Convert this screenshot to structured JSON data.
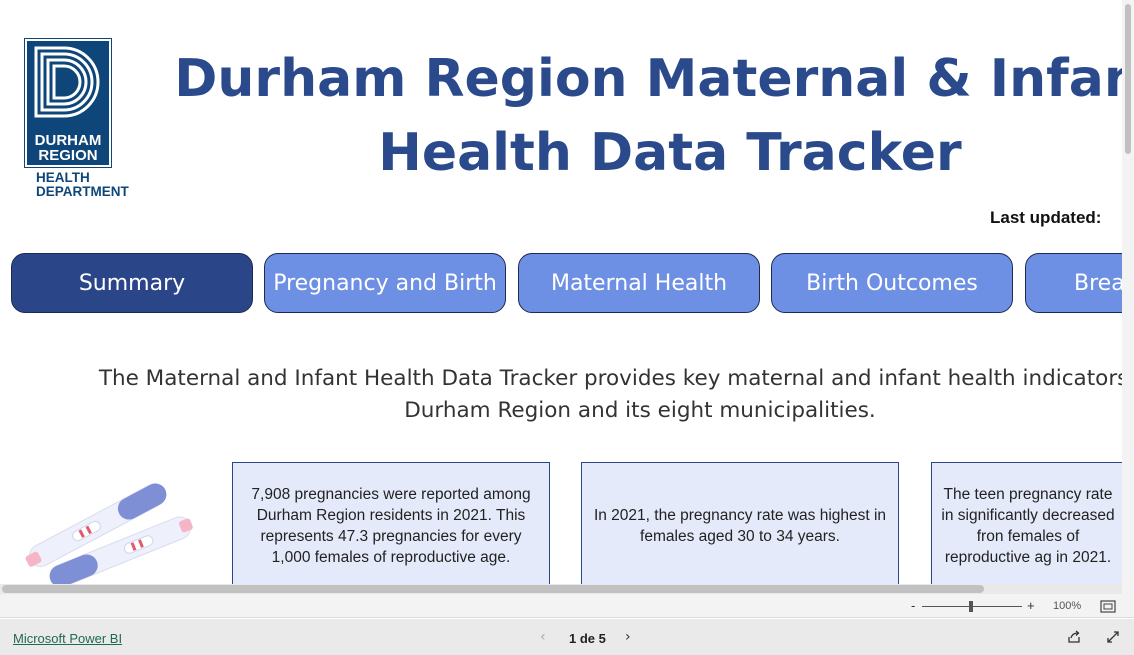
{
  "logo": {
    "line1": "DURHAM",
    "line2": "REGION",
    "line3": "HEALTH",
    "line4": "DEPARTMENT",
    "color": "#0f4679"
  },
  "header": {
    "title_line1": "Durham Region Maternal & Infant",
    "title_line2": "Health Data Tracker",
    "last_updated_label": "Last updated:",
    "title_color": "#2a4a8c"
  },
  "tabs": [
    {
      "label": "Summary",
      "active": true
    },
    {
      "label": "Pregnancy and Birth",
      "active": false
    },
    {
      "label": "Maternal Health",
      "active": false
    },
    {
      "label": "Birth Outcomes",
      "active": false
    },
    {
      "label": "Breas",
      "active": false
    }
  ],
  "colors": {
    "tab_active": "#2b4589",
    "tab_inactive": "#6d8fe4",
    "card_bg": "#e4eaf9"
  },
  "intro": {
    "line1": "The Maternal and Infant Health Data Tracker provides key maternal and infant health indicators by y",
    "line2": "Durham Region and its eight municipalities."
  },
  "cards": [
    {
      "text": "7,908 pregnancies were reported among Durham Region residents in 2021. This represents 47.3 pregnancies for every 1,000 females of reproductive age."
    },
    {
      "text": "In 2021, the pregnancy rate was highest in females aged 30 to 34 years."
    },
    {
      "text": "The teen pregnancy rate in significantly decreased fron females of reproductive ag in 2021."
    }
  ],
  "icons": {
    "illustration": "pregnancy-tests-icon",
    "zoom_fit": "fit-to-page-icon",
    "share": "share-icon",
    "fullscreen": "fullscreen-icon"
  },
  "zoom": {
    "minus": "-",
    "plus": "+",
    "level_label": "100%"
  },
  "footer": {
    "brand_link": "Microsoft Power BI",
    "page_indicator": "1 de 5",
    "prev": "‹",
    "next": "›"
  }
}
